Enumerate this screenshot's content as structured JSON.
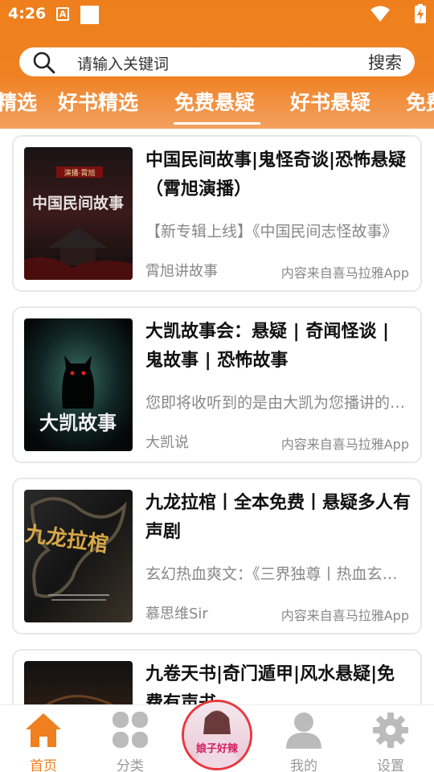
{
  "status_bar": {
    "time": "4:26",
    "a_icon": "A"
  },
  "search": {
    "placeholder": "请输入关键词",
    "button_label": "搜索"
  },
  "tabs": [
    {
      "label": "精选"
    },
    {
      "label": "好书精选"
    },
    {
      "label": "免费悬疑",
      "active": true
    },
    {
      "label": "好书悬疑"
    },
    {
      "label": "免费"
    }
  ],
  "books": [
    {
      "title": "中国民间故事|鬼怪奇谈|恐怖悬疑（霄旭演播）",
      "desc": "【新专辑上线】《中国民间志怪故事》",
      "author": "霄旭讲故事",
      "source": "内容来自喜马拉雅App",
      "cover_text": "中国民间故事",
      "cover_badge": "演播·霄旭"
    },
    {
      "title": "大凯故事会：悬疑 | 奇闻怪谈 | 鬼故事 | 恐怖故事",
      "desc": "您即将收听到的是由大凯为您播讲的故事",
      "author": "大凯说",
      "source": "内容来自喜马拉雅App",
      "cover_text": "大凯故事"
    },
    {
      "title": "九龙拉棺丨全本免费丨悬疑多人有声剧",
      "desc": "玄幻热血爽文：《三界独尊丨热血玄幻》",
      "author": "慕思维Sir",
      "source": "内容来自喜马拉雅App",
      "cover_text": "九龙拉棺"
    },
    {
      "title": "九卷天书|奇门遁甲|风水悬疑|免费有声书",
      "desc": "",
      "author": "",
      "source": "",
      "cover_text": ""
    }
  ],
  "bottom_nav": [
    {
      "label": "首页",
      "icon": "home-icon",
      "active": true
    },
    {
      "label": "分类",
      "icon": "category-icon"
    },
    {
      "label": "",
      "icon": "featured-disc"
    },
    {
      "label": "我的",
      "icon": "user-icon"
    },
    {
      "label": "设置",
      "icon": "gear-icon"
    }
  ],
  "center_disc_text": "娘子好辣",
  "colors": {
    "brand": "#ef7f1f",
    "text": "#111111",
    "muted": "#888888",
    "nav_inactive": "#999999"
  }
}
